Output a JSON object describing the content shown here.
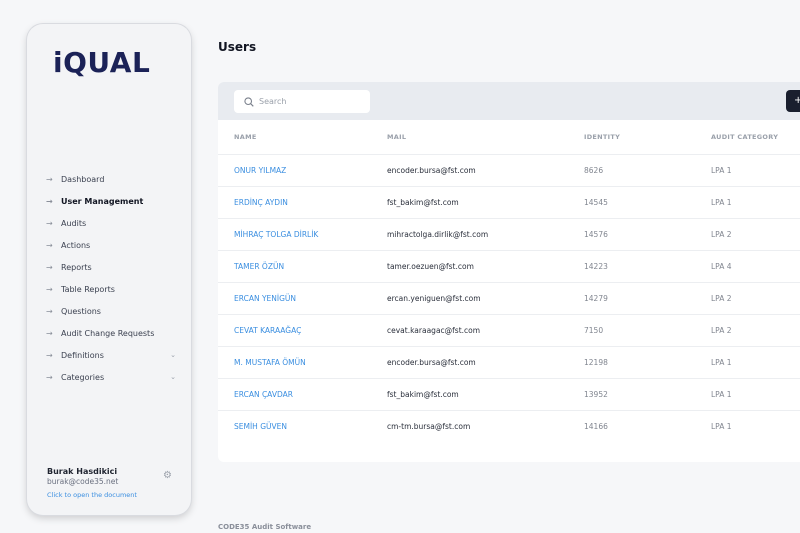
{
  "app": {
    "logo": "iQUAL",
    "footer": "CODE35 Audit Software"
  },
  "sidebar": {
    "items": [
      {
        "label": "Dashboard",
        "active": false,
        "expandable": false
      },
      {
        "label": "User Management",
        "active": true,
        "expandable": false
      },
      {
        "label": "Audits",
        "active": false,
        "expandable": false
      },
      {
        "label": "Actions",
        "active": false,
        "expandable": false
      },
      {
        "label": "Reports",
        "active": false,
        "expandable": false
      },
      {
        "label": "Table Reports",
        "active": false,
        "expandable": false
      },
      {
        "label": "Questions",
        "active": false,
        "expandable": false
      },
      {
        "label": "Audit Change Requests",
        "active": false,
        "expandable": false
      },
      {
        "label": "Definitions",
        "active": false,
        "expandable": true
      },
      {
        "label": "Categories",
        "active": false,
        "expandable": true
      }
    ],
    "user": {
      "name": "Burak Hasdikici",
      "email": "burak@code35.net",
      "doc_link": "Click to open the document"
    }
  },
  "main": {
    "title": "Users",
    "search": {
      "placeholder": "Search",
      "value": ""
    },
    "add_button": "+",
    "table": {
      "columns": [
        "NAME",
        "MAIL",
        "IDENTITY",
        "AUDIT CATEGORY"
      ],
      "rows": [
        [
          "ONUR YILMAZ",
          "encoder.bursa@fst.com",
          "8626",
          "LPA 1"
        ],
        [
          "ERDİNÇ AYDIN",
          "fst_bakim@fst.com",
          "14545",
          "LPA 1"
        ],
        [
          "MİHRAÇ TOLGA DİRLİK",
          "mihractolga.dirlik@fst.com",
          "14576",
          "LPA 2"
        ],
        [
          "TAMER ÖZÜN",
          "tamer.oezuen@fst.com",
          "14223",
          "LPA 4"
        ],
        [
          "ERCAN YENİGÜN",
          "ercan.yeniguen@fst.com",
          "14279",
          "LPA 2"
        ],
        [
          "CEVAT KARAAĞAÇ",
          "cevat.karaagac@fst.com",
          "7150",
          "LPA 2"
        ],
        [
          "M. MUSTAFA ÖMÜN",
          "encoder.bursa@fst.com",
          "12198",
          "LPA 1"
        ],
        [
          "ERCAN ÇAVDAR",
          "fst_bakim@fst.com",
          "13952",
          "LPA 1"
        ],
        [
          "SEMİH GÜVEN",
          "cm-tm.bursa@fst.com",
          "14166",
          "LPA 1"
        ]
      ]
    }
  },
  "colors": {
    "brand": "#1b2257",
    "link": "#3a8ee0",
    "toolbar": "#e8ebf0",
    "button": "#1a1f2e"
  },
  "icons": {
    "nav_arrow": "arrow-right-icon",
    "expand": "chevron-down-icon",
    "search": "search-icon",
    "settings": "gear-icon"
  }
}
